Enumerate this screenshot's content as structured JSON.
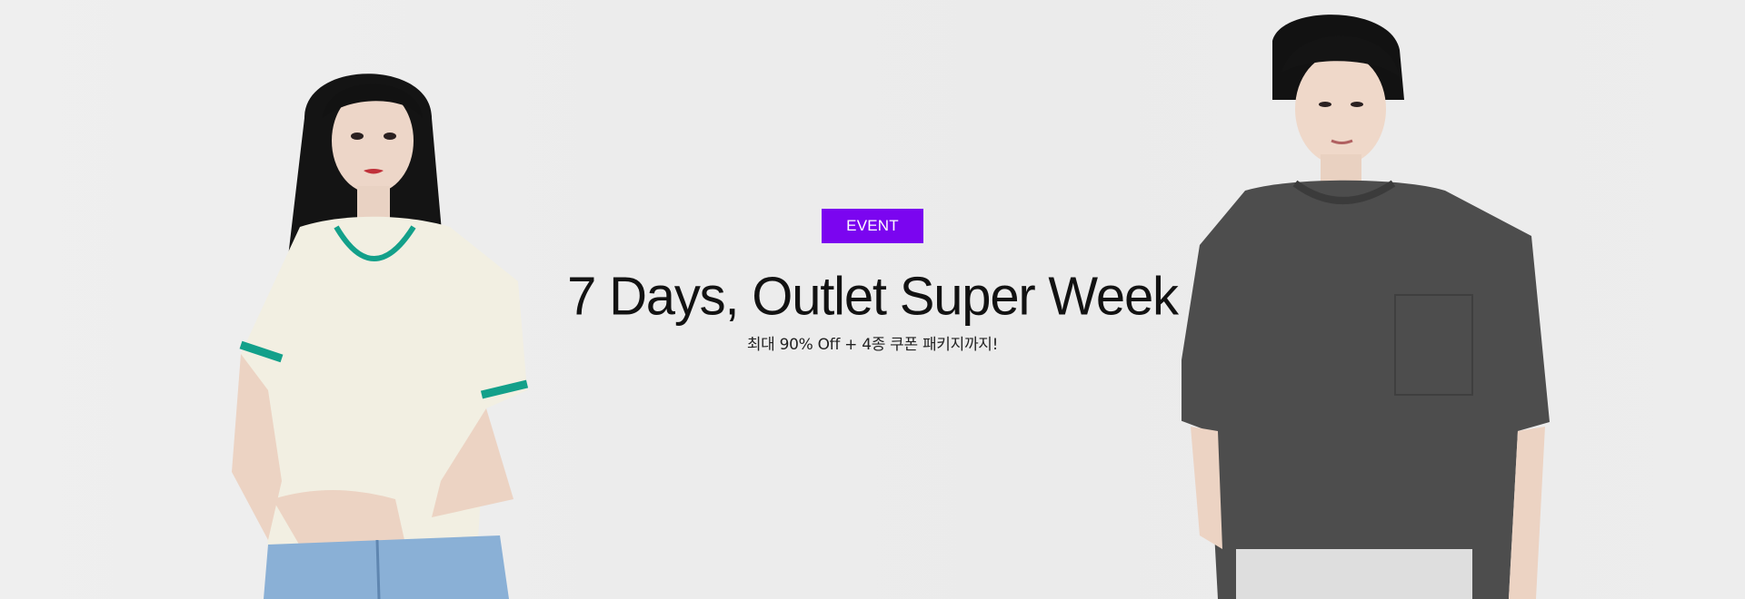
{
  "hero": {
    "badge": "EVENT",
    "title": "7 Days, Outlet Super Week",
    "subtitle": "최대 90% Off + 4종 쿠폰 패키지까지!"
  },
  "colors": {
    "background": "#ececec",
    "badge": "#7b05f0",
    "title": "#121212"
  },
  "images": {
    "left_model": "woman-in-cream-knit-top-icon",
    "right_model": "man-in-charcoal-tshirt-icon"
  }
}
